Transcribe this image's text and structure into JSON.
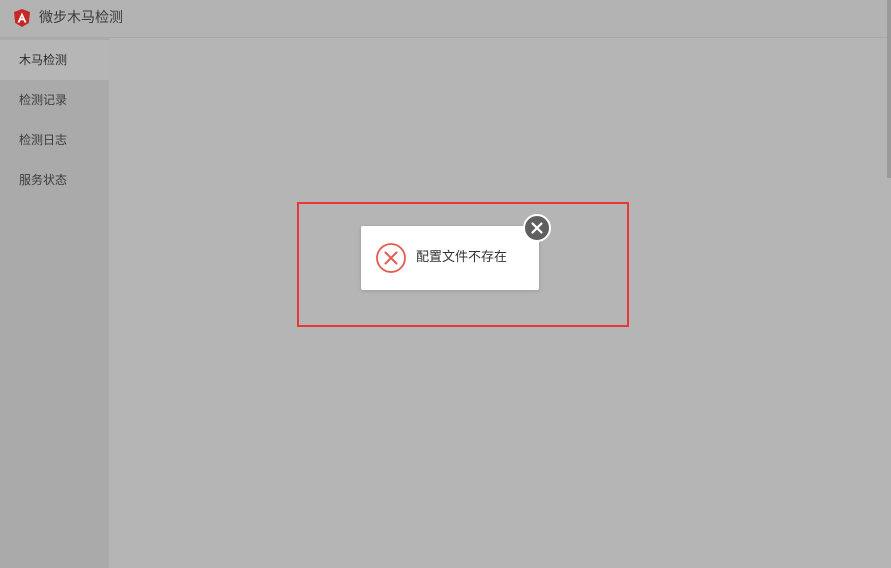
{
  "app": {
    "title": "微步木马检测"
  },
  "sidebar": {
    "items": [
      {
        "label": "木马检测",
        "active": true
      },
      {
        "label": "检测记录",
        "active": false
      },
      {
        "label": "检测日志",
        "active": false
      },
      {
        "label": "服务状态",
        "active": false
      }
    ]
  },
  "toast": {
    "message": "配置文件不存在",
    "icon": "error-circle-icon",
    "close_icon": "close-icon"
  },
  "colors": {
    "logo": "#c62828",
    "error": "#e55a4e",
    "highlight": "#e53935",
    "close_button": "#5f5f5f"
  }
}
